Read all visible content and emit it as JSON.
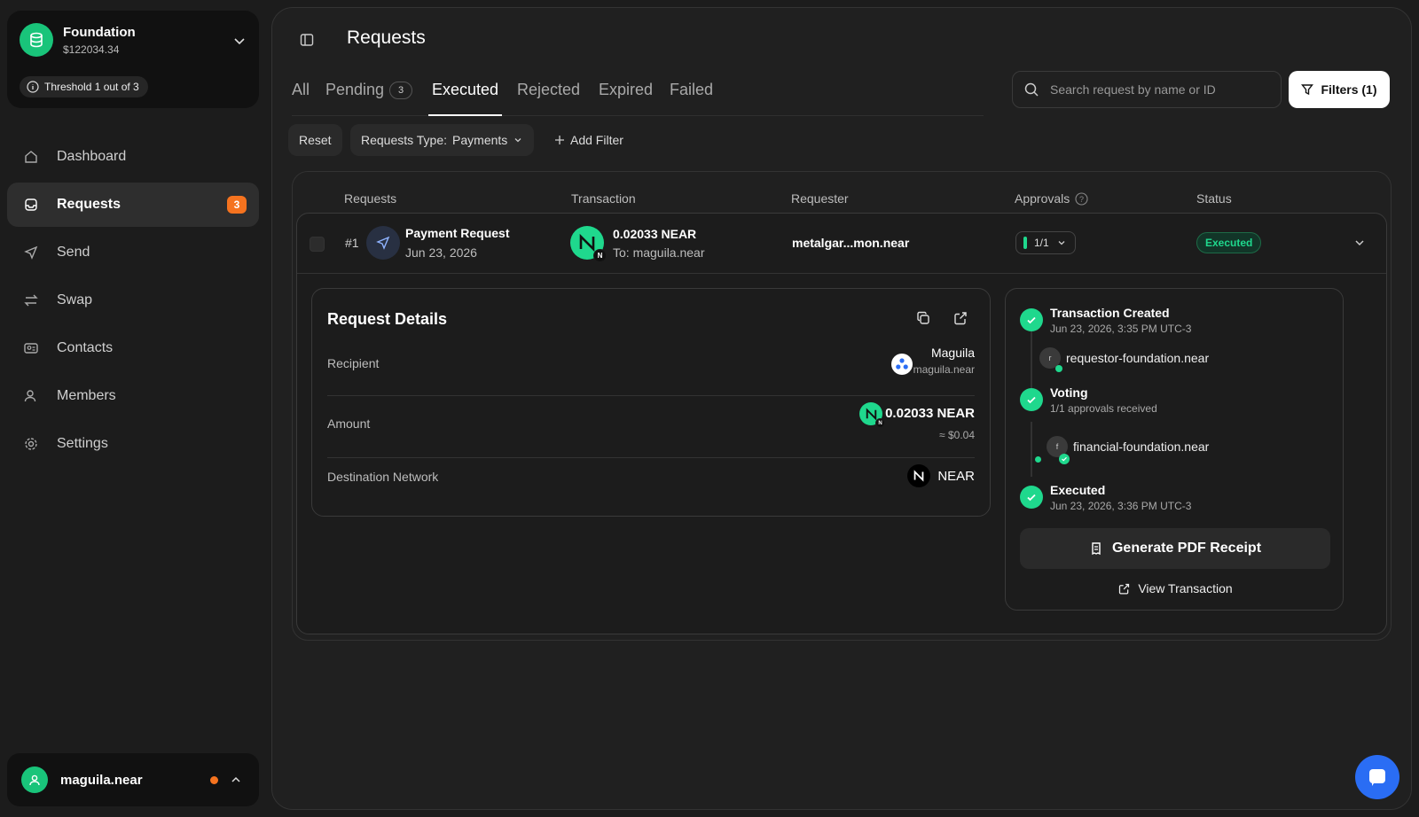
{
  "org": {
    "name": "Foundation",
    "balance": "$122034.34",
    "threshold": "Threshold 1 out of 3"
  },
  "nav": [
    {
      "label": "Dashboard",
      "icon": "home-icon"
    },
    {
      "label": "Requests",
      "icon": "inbox-icon",
      "badge": "3",
      "active": true
    },
    {
      "label": "Send",
      "icon": "send-icon"
    },
    {
      "label": "Swap",
      "icon": "swap-icon"
    },
    {
      "label": "Contacts",
      "icon": "contacts-icon"
    },
    {
      "label": "Members",
      "icon": "members-icon"
    },
    {
      "label": "Settings",
      "icon": "gear-icon"
    }
  ],
  "user": {
    "name": "maguila.near"
  },
  "page": {
    "title": "Requests"
  },
  "tabs": [
    {
      "label": "All"
    },
    {
      "label": "Pending",
      "count": "3"
    },
    {
      "label": "Executed",
      "active": true
    },
    {
      "label": "Rejected"
    },
    {
      "label": "Expired"
    },
    {
      "label": "Failed"
    }
  ],
  "search": {
    "placeholder": "Search request by name or ID"
  },
  "filters_button": "Filters (1)",
  "filter_chips": {
    "reset": "Reset",
    "type_label": "Requests Type:",
    "type_value": "Payments",
    "add_filter": "Add Filter"
  },
  "table": {
    "headers": {
      "requests": "Requests",
      "transaction": "Transaction",
      "requester": "Requester",
      "approvals": "Approvals",
      "status": "Status"
    },
    "row": {
      "number": "#1",
      "name": "Payment Request",
      "date": "Jun 23, 2026",
      "amount": "0.02033 NEAR",
      "to": "To: maguila.near",
      "requester": "metalgar...mon.near",
      "approvals": "1/1",
      "status": "Executed"
    }
  },
  "details": {
    "title": "Request Details",
    "recipient_label": "Recipient",
    "recipient_name": "Maguila",
    "recipient_account": "maguila.near",
    "amount_label": "Amount",
    "amount_value": "0.02033 NEAR",
    "amount_usd": "≈ $0.04",
    "network_label": "Destination Network",
    "network_value": "NEAR"
  },
  "timeline": {
    "created_title": "Transaction Created",
    "created_time": "Jun 23, 2026, 3:35 PM UTC-3",
    "created_by": "requestor-foundation.near",
    "created_initial": "r",
    "voting_title": "Voting",
    "voting_sub": "1/1 approvals received",
    "voter": "financial-foundation.near",
    "voter_initial": "f",
    "executed_title": "Executed",
    "executed_time": "Jun 23, 2026, 3:36 PM UTC-3",
    "generate_pdf": "Generate PDF Receipt",
    "view_tx": "View Transaction"
  },
  "colors": {
    "accent_green": "#1fd88d",
    "badge_orange": "#f5731f",
    "chat_blue": "#2a6df4"
  }
}
